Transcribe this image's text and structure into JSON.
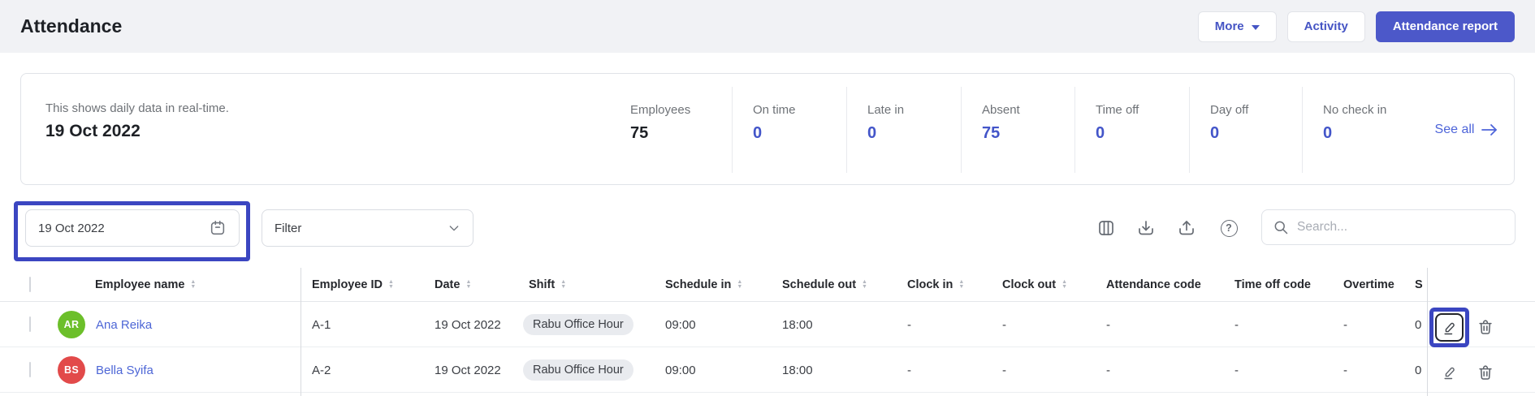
{
  "header": {
    "title": "Attendance",
    "buttons": {
      "more": "More",
      "activity": "Activity",
      "report": "Attendance report"
    }
  },
  "summary": {
    "subtitle": "This shows daily data in real-time.",
    "date": "19 Oct 2022",
    "stats": [
      {
        "label": "Employees",
        "value": "75",
        "emphasis": "dark"
      },
      {
        "label": "On time",
        "value": "0",
        "emphasis": "blue"
      },
      {
        "label": "Late in",
        "value": "0",
        "emphasis": "blue"
      },
      {
        "label": "Absent",
        "value": "75",
        "emphasis": "blue"
      },
      {
        "label": "Time off",
        "value": "0",
        "emphasis": "blue"
      },
      {
        "label": "Day off",
        "value": "0",
        "emphasis": "blue"
      },
      {
        "label": "No check in",
        "value": "0",
        "emphasis": "blue"
      }
    ],
    "see_all": "See all"
  },
  "toolbar": {
    "date_value": "19 Oct 2022",
    "filter_label": "Filter",
    "search_placeholder": "Search...",
    "icons": [
      "calendar-icon",
      "chevron-down-icon",
      "columns-icon",
      "download-icon",
      "export-icon",
      "help-icon",
      "search-icon"
    ]
  },
  "table": {
    "columns": [
      {
        "label": "Employee name"
      },
      {
        "label": "Employee ID"
      },
      {
        "label": "Date"
      },
      {
        "label": "Shift"
      },
      {
        "label": "Schedule in"
      },
      {
        "label": "Schedule out"
      },
      {
        "label": "Clock in"
      },
      {
        "label": "Clock out"
      },
      {
        "label": "Attendance code"
      },
      {
        "label": "Time off code"
      },
      {
        "label": "Overtime"
      },
      {
        "label": "S"
      }
    ],
    "rows": [
      {
        "initials": "AR",
        "avatar_style": "background:#6cbf2a",
        "name": "Ana Reika",
        "employee_id": "A-1",
        "date": "19 Oct 2022",
        "shift": "Rabu Office Hour",
        "schedule_in": "09:00",
        "schedule_out": "18:00",
        "clock_in": "-",
        "clock_out": "-",
        "attendance_code": "-",
        "time_off_code": "-",
        "overtime": "-",
        "s_value": "0"
      },
      {
        "initials": "BS",
        "avatar_style": "background:#e24a4a",
        "name": "Bella Syifa",
        "employee_id": "A-2",
        "date": "19 Oct 2022",
        "shift": "Rabu Office Hour",
        "schedule_in": "09:00",
        "schedule_out": "18:00",
        "clock_in": "-",
        "clock_out": "-",
        "attendance_code": "-",
        "time_off_code": "-",
        "overtime": "-",
        "s_value": "0"
      }
    ]
  },
  "colors": {
    "accent": "#4c58c9",
    "annotation_highlight": "#3b46c1",
    "link": "#4d66d6",
    "stat_blue": "#4355c9",
    "avatar_green": "#6cbf2a",
    "avatar_red": "#e24a4a",
    "topbar_bg": "#f1f2f5",
    "chip_bg": "#e9ebef"
  }
}
